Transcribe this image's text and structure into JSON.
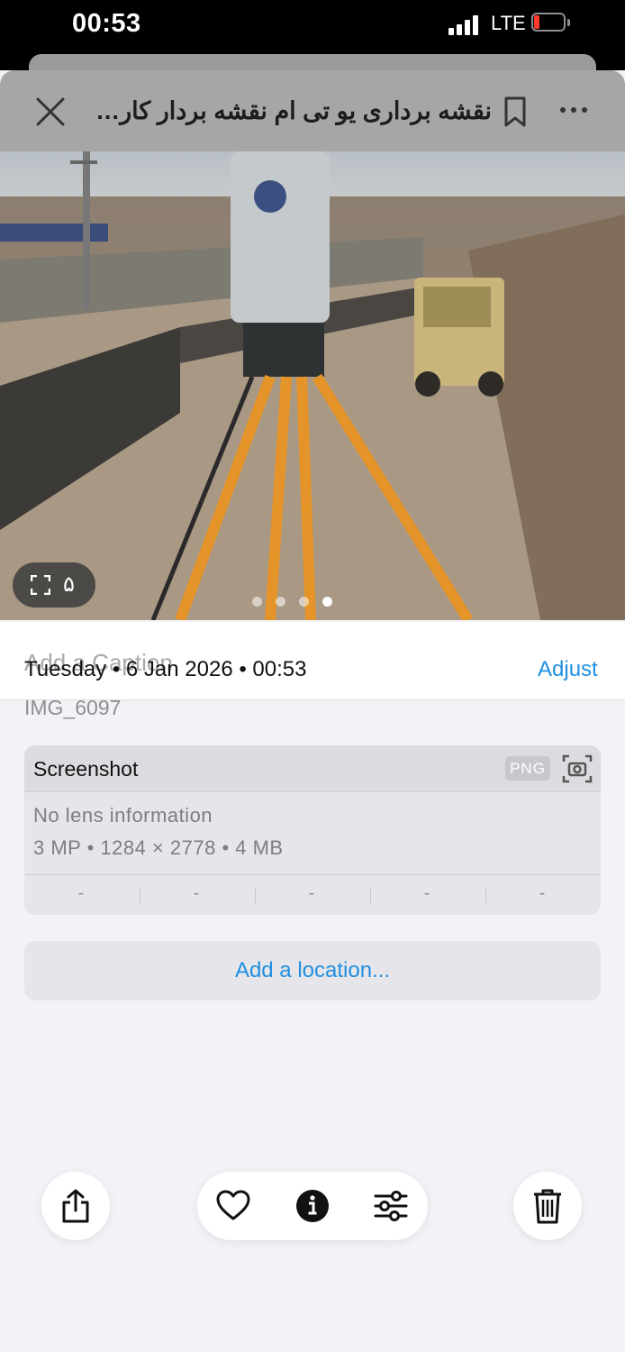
{
  "status": {
    "time": "00:53",
    "network": "LTE"
  },
  "header": {
    "title": "نقشه برداری  یو تی ام نقشه بردار کارشناس"
  },
  "photo": {
    "count_label": "۵",
    "page_dots": 4,
    "active_dot": 3
  },
  "caption": {
    "placeholder": "Add a Caption"
  },
  "info": {
    "date_line": "Tuesday • 6 Jan 2026 • 00:53",
    "adjust_label": "Adjust",
    "filename": "IMG_6097",
    "card": {
      "title": "Screenshot",
      "format_badge": "PNG",
      "lens": "No lens information",
      "specs": "3 MP • 1284 × 2778 • 4 MB",
      "exif": [
        "-",
        "-",
        "-",
        "-",
        "-"
      ]
    },
    "location_label": "Add a location..."
  },
  "toolbar": {
    "icons": [
      "share-icon",
      "heart-icon",
      "info-icon",
      "adjust-sliders-icon",
      "trash-icon"
    ]
  },
  "colors": {
    "accent": "#1f8fe0",
    "battery_low": "#ff3b30",
    "background": "#f2f2f7"
  }
}
